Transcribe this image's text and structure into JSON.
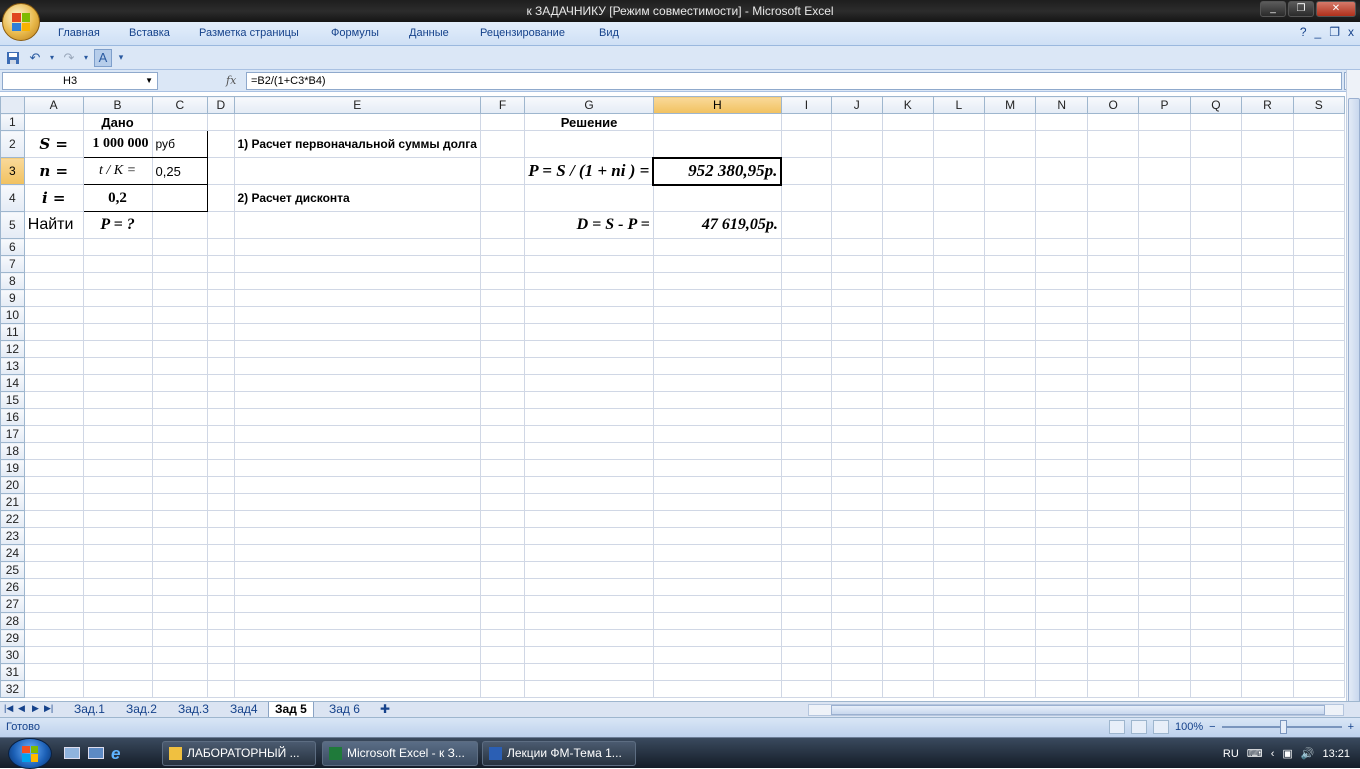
{
  "window": {
    "title": "к ЗАДАЧНИКУ  [Режим совместимости] - Microsoft Excel",
    "controls": [
      "_",
      "❐",
      "✕"
    ]
  },
  "ribbon": {
    "tabs": [
      "Главная",
      "Вставка",
      "Разметка страницы",
      "Формулы",
      "Данные",
      "Рецензирование",
      "Вид"
    ],
    "help": "?",
    "min": "_",
    "restore": "❐",
    "close": "x"
  },
  "formula_bar": {
    "name_box": "H3",
    "fx": "fx",
    "formula": "=B2/(1+C3*B4)"
  },
  "columns": [
    "A",
    "B",
    "C",
    "D",
    "E",
    "F",
    "G",
    "H",
    "I",
    "J",
    "K",
    "L",
    "M",
    "N",
    "O",
    "P",
    "Q",
    "R",
    "S"
  ],
  "selected": {
    "col": "H",
    "row": "3"
  },
  "cells": {
    "B1": "Дано",
    "G1": "Решение",
    "A2": "S =",
    "B2": "1 000 000",
    "C2": "руб",
    "E2": "1) Расчет первоначальной суммы долга",
    "A3": "n =",
    "B3": "t / K =",
    "C3": "0,25",
    "G3": "P = S / (1 + ni )  =",
    "H3": "952 380,95р.",
    "A4": "i =",
    "B4": "0,2",
    "E4": "2) Расчет дисконта",
    "A5": "Найти",
    "B5": "P  =  ?",
    "G5": "D = S - P =",
    "H5": "47 619,05р."
  },
  "sheets": {
    "tabs": [
      "Зад.1",
      "Зад.2",
      "Зад.3",
      "Зад4",
      "Зад 5",
      "Зад 6"
    ],
    "active": "Зад 5"
  },
  "status": {
    "text": "Готово",
    "zoom": "100%",
    "minus": "−",
    "plus": "+"
  },
  "taskbar": {
    "items": [
      "ЛАБОРАТОРНЫЙ ...",
      "Microsoft Excel - к З...",
      "Лекции ФМ-Тема 1..."
    ],
    "lang": "RU",
    "time": "13:21"
  },
  "colors": {
    "accent": "#15428b",
    "selected_header": "#f1c15f",
    "gridline": "#d0d7e5"
  }
}
